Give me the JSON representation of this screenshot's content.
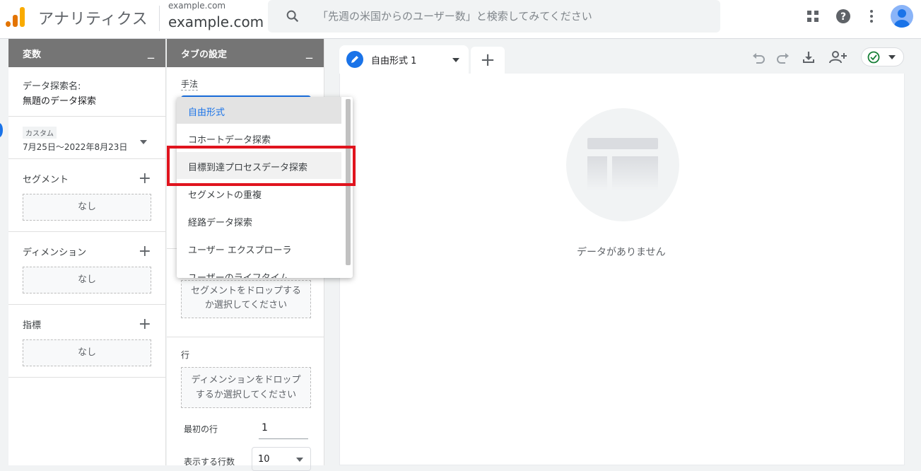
{
  "topbar": {
    "app_title": "アナリティクス",
    "account_small": "example.com",
    "account_large": "example.com",
    "search_placeholder": "「先週の米国からのユーザー数」と検索してみてください"
  },
  "variables_panel": {
    "header": "変数",
    "collapse": "_",
    "exploration_name_label": "データ探索名:",
    "exploration_name": "無題のデータ探索",
    "date_badge": "カスタム",
    "date_range": "7月25日～2022年8月23日",
    "segments_label": "セグメント",
    "segments_value": "なし",
    "dimensions_label": "ディメンション",
    "dimensions_value": "なし",
    "metrics_label": "指標",
    "metrics_value": "なし"
  },
  "tab_settings": {
    "header": "タブの設定",
    "collapse": "_",
    "technique_label": "手法",
    "segment_drop": "セグメントをドロップするか選択してください",
    "rows_label": "行",
    "rows_drop": "ディメンションをドロップするか選択してください",
    "first_row_label": "最初の行",
    "first_row_value": "1",
    "rows_shown_label": "表示する行数",
    "rows_shown_value": "10"
  },
  "technique_menu": {
    "items": [
      "自由形式",
      "コホートデータ探索",
      "目標到達プロセスデータ探索",
      "セグメントの重複",
      "経路データ探索",
      "ユーザー エクスプローラ",
      "ユーザーのライフタイム"
    ],
    "selected_index": 0,
    "highlighted_index": 2
  },
  "canvas": {
    "tab_label": "自由形式 1",
    "add_tab": "+",
    "empty_message": "データがありません"
  },
  "colors": {
    "accent": "#1a73e8",
    "highlight_box": "#e0141e",
    "panel_header": "#757575",
    "status_check": "#188038"
  }
}
